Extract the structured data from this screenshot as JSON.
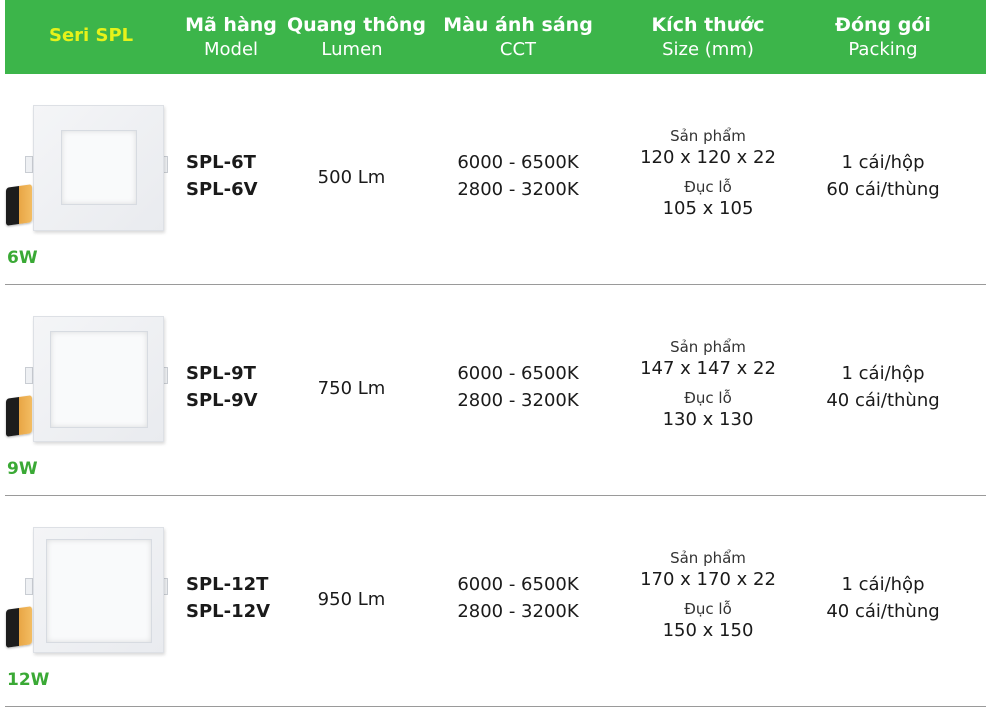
{
  "header": {
    "series": "Seri SPL",
    "columns": [
      {
        "vi": "Mã hàng",
        "en": "Model"
      },
      {
        "vi": "Quang thông",
        "en": "Lumen"
      },
      {
        "vi": "Màu ánh sáng",
        "en": "CCT"
      },
      {
        "vi": "Kích thước",
        "en": "Size (mm)"
      },
      {
        "vi": "Đóng gói",
        "en": "Packing"
      }
    ]
  },
  "rows": [
    {
      "watt": "6W",
      "models": [
        "SPL-6T",
        "SPL-6V"
      ],
      "lumen": "500 Lm",
      "cct": [
        "6000 - 6500K",
        "2800 - 3200K"
      ],
      "size": {
        "product_label": "Sản phẩm",
        "product": "120 x 120 x 22",
        "cutout_label": "Đục lỗ",
        "cutout": "105 x 105"
      },
      "packing": [
        "1 cái/hộp",
        "60 cái/thùng"
      ]
    },
    {
      "watt": "9W",
      "models": [
        "SPL-9T",
        "SPL-9V"
      ],
      "lumen": "750 Lm",
      "cct": [
        "6000 - 6500K",
        "2800 - 3200K"
      ],
      "size": {
        "product_label": "Sản phẩm",
        "product": "147 x 147 x 22",
        "cutout_label": "Đục lỗ",
        "cutout": "130 x 130"
      },
      "packing": [
        "1 cái/hộp",
        "40 cái/thùng"
      ]
    },
    {
      "watt": "12W",
      "models": [
        "SPL-12T",
        "SPL-12V"
      ],
      "lumen": "950 Lm",
      "cct": [
        "6000 - 6500K",
        "2800 - 3200K"
      ],
      "size": {
        "product_label": "Sản phẩm",
        "product": "170 x 170 x 22",
        "cutout_label": "Đục lỗ",
        "cutout": "150 x 150"
      },
      "packing": [
        "1 cái/hộp",
        "40 cái/thùng"
      ]
    }
  ]
}
